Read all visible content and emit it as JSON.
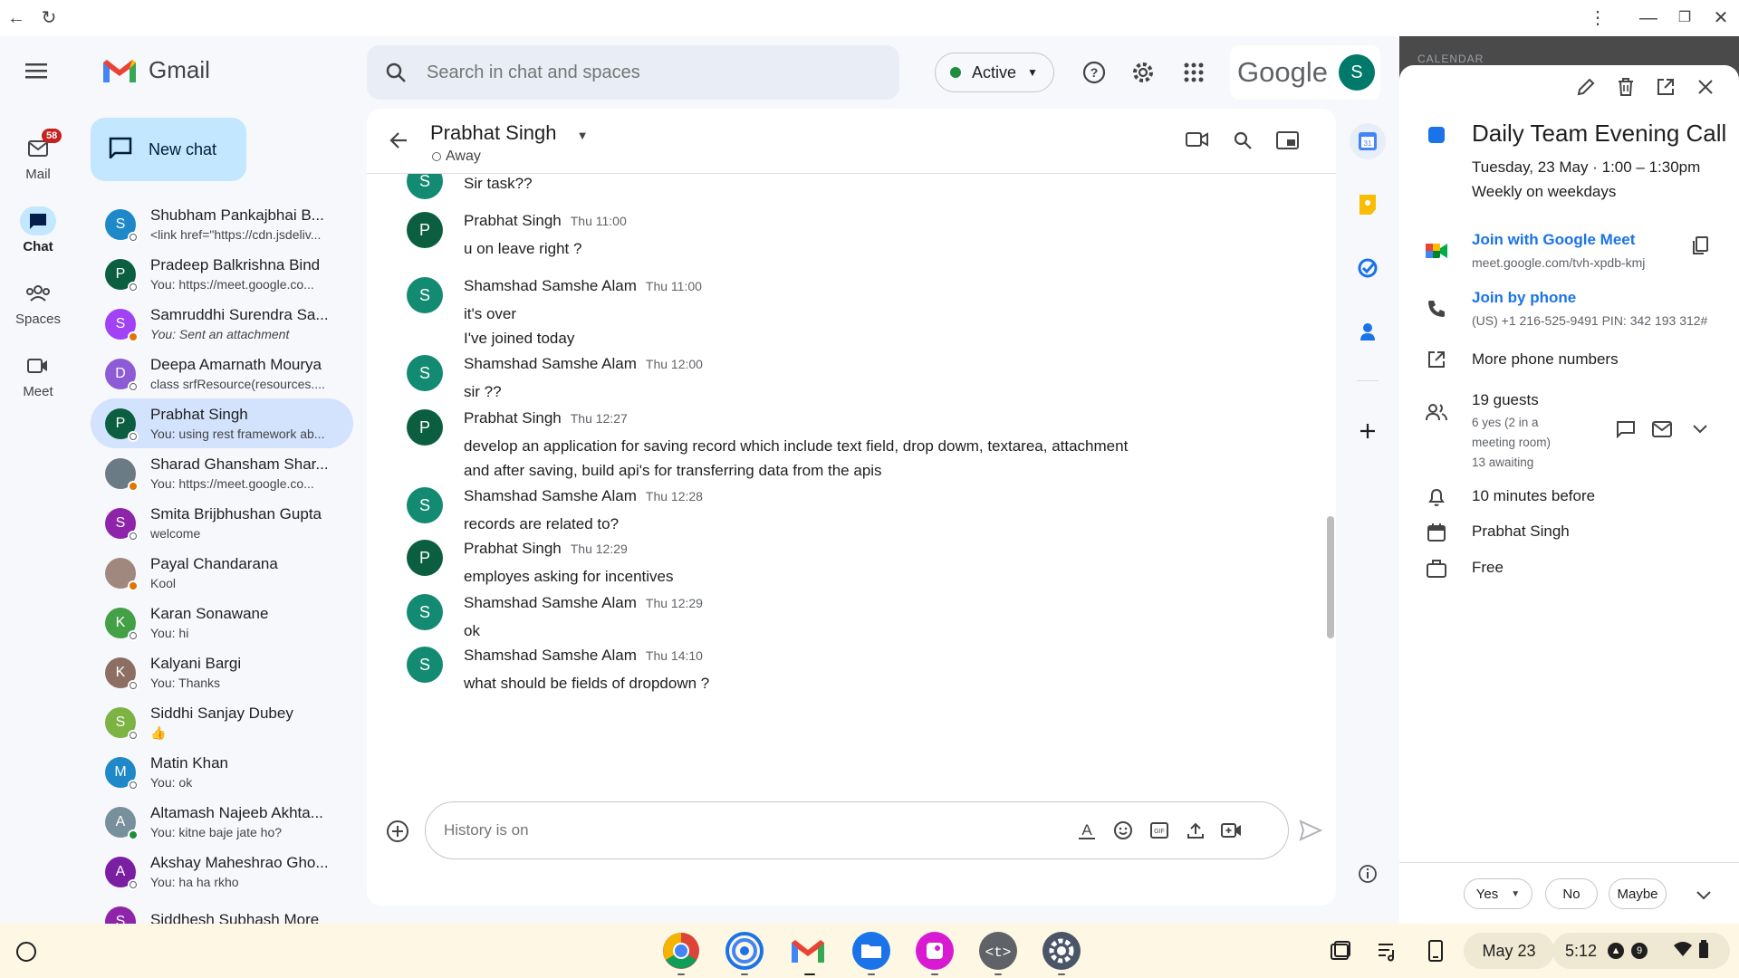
{
  "mail": {
    "label": "Mail",
    "badge": "58"
  },
  "nav": {
    "chat": "Chat",
    "spaces": "Spaces",
    "meet": "Meet"
  },
  "brand": {
    "name": "Gmail"
  },
  "new_chat": {
    "label": "New chat"
  },
  "search": {
    "placeholder": "Search in chat and spaces"
  },
  "status": {
    "label": "Active"
  },
  "account": {
    "wordmark": "Google",
    "initial": "S"
  },
  "chats": [
    {
      "name": "Shubham Pankajbhai B...",
      "preview": "<link href=\"https://cdn.jsdeliv...",
      "initial": "S",
      "color": "#1e88c8"
    },
    {
      "name": "Pradeep Balkrishna Bind",
      "preview": "You: https://meet.google.co...",
      "initial": "P",
      "color": "#0b5f40"
    },
    {
      "name": "Samruddhi Surendra Sa...",
      "preview": "You: Sent an attachment",
      "initial": "S",
      "color": "#a142f4"
    },
    {
      "name": "Deepa Amarnath Mourya",
      "preview": "class srfResource(resources....",
      "initial": "D",
      "color": "#8e5bd6"
    },
    {
      "name": "Prabhat Singh",
      "preview": "You: using rest framework ab...",
      "initial": "P",
      "color": "#0b5f40"
    },
    {
      "name": "Sharad Ghansham Shar...",
      "preview": "You: https://meet.google.co...",
      "initial": "",
      "color": "#6b7b86"
    },
    {
      "name": "Smita Brijbhushan Gupta",
      "preview": "welcome",
      "initial": "S",
      "color": "#8e24aa"
    },
    {
      "name": "Payal Chandarana",
      "preview": "Kool",
      "initial": "",
      "color": "#a1887f"
    },
    {
      "name": "Karan Sonawane",
      "preview": "You: hi",
      "initial": "K",
      "color": "#43a047"
    },
    {
      "name": "Kalyani Bargi",
      "preview": "You: Thanks",
      "initial": "K",
      "color": "#8d6e63"
    },
    {
      "name": "Siddhi Sanjay Dubey",
      "preview": "👍",
      "initial": "S",
      "color": "#7cb342"
    },
    {
      "name": "Matin Khan",
      "preview": "You: ok",
      "initial": "M",
      "color": "#1e88c8"
    },
    {
      "name": "Altamash Najeeb Akhta...",
      "preview": "You: kitne baje jate ho?",
      "initial": "A",
      "color": "#78909c"
    },
    {
      "name": "Akshay Maheshrao Gho...",
      "preview": "You: ha ha rkho",
      "initial": "A",
      "color": "#7b1fa2"
    },
    {
      "name": "Siddhesh Subhash More",
      "preview": "",
      "initial": "S",
      "color": "#8e24aa"
    }
  ],
  "conversation": {
    "title": "Prabhat Singh",
    "presence": "Away",
    "messages": [
      {
        "author": "",
        "time": "",
        "initial": "S",
        "color": "#138a72",
        "lines": [
          "Sir task??"
        ]
      },
      {
        "author": "Prabhat Singh",
        "time": "Thu 11:00",
        "initial": "P",
        "color": "#0b5f40",
        "lines": [
          "u on leave right ?"
        ]
      },
      {
        "author": "Shamshad Samshe Alam",
        "time": "Thu 11:00",
        "initial": "S",
        "color": "#138a72",
        "lines": [
          "it's over",
          "I've joined today"
        ]
      },
      {
        "author": "Shamshad Samshe Alam",
        "time": "Thu 12:00",
        "initial": "S",
        "color": "#138a72",
        "lines": [
          "sir ??"
        ]
      },
      {
        "author": "Prabhat Singh",
        "time": "Thu 12:27",
        "initial": "P",
        "color": "#0b5f40",
        "lines": [
          "develop an application for saving record which include text field, drop dowm, textarea, attachment",
          "and after saving, build api's for transferring data from the apis"
        ]
      },
      {
        "author": "Shamshad Samshe Alam",
        "time": "Thu 12:28",
        "initial": "S",
        "color": "#138a72",
        "lines": [
          "records are related to?"
        ]
      },
      {
        "author": "Prabhat Singh",
        "time": "Thu 12:29",
        "initial": "P",
        "color": "#0b5f40",
        "lines": [
          "employes asking for incentives"
        ]
      },
      {
        "author": "Shamshad Samshe Alam",
        "time": "Thu 12:29",
        "initial": "S",
        "color": "#138a72",
        "lines": [
          "ok"
        ]
      },
      {
        "author": "Shamshad Samshe Alam",
        "time": "Thu 14:10",
        "initial": "S",
        "color": "#138a72",
        "lines": [
          "what should be fields of dropdown ?"
        ]
      }
    ],
    "composer_placeholder": "History is on"
  },
  "calendar": {
    "section": "CALENDAR",
    "title": "Daily Team Evening Call",
    "date": "Tuesday, 23 May  ·  1:00 – 1:30pm",
    "recurrence": "Weekly on weekdays",
    "meet_label": "Join with Google Meet",
    "meet_link": "meet.google.com/tvh-xpdb-kmj",
    "phone_label": "Join by phone",
    "phone_detail": "(US) +1 216-525-9491 PIN: 342 193 312#",
    "more_phones": "More phone numbers",
    "guests": "19 guests",
    "guests_yes": "6 yes (2 in a",
    "guests_room": "meeting room)",
    "guests_awaiting": "13 awaiting",
    "reminder": "10 minutes before",
    "organizer": "Prabhat Singh",
    "availability": "Free",
    "rsvp": {
      "yes": "Yes",
      "no": "No",
      "maybe": "Maybe"
    }
  },
  "shelf": {
    "date": "May 23",
    "time": "5:12",
    "notif_count": "9"
  }
}
